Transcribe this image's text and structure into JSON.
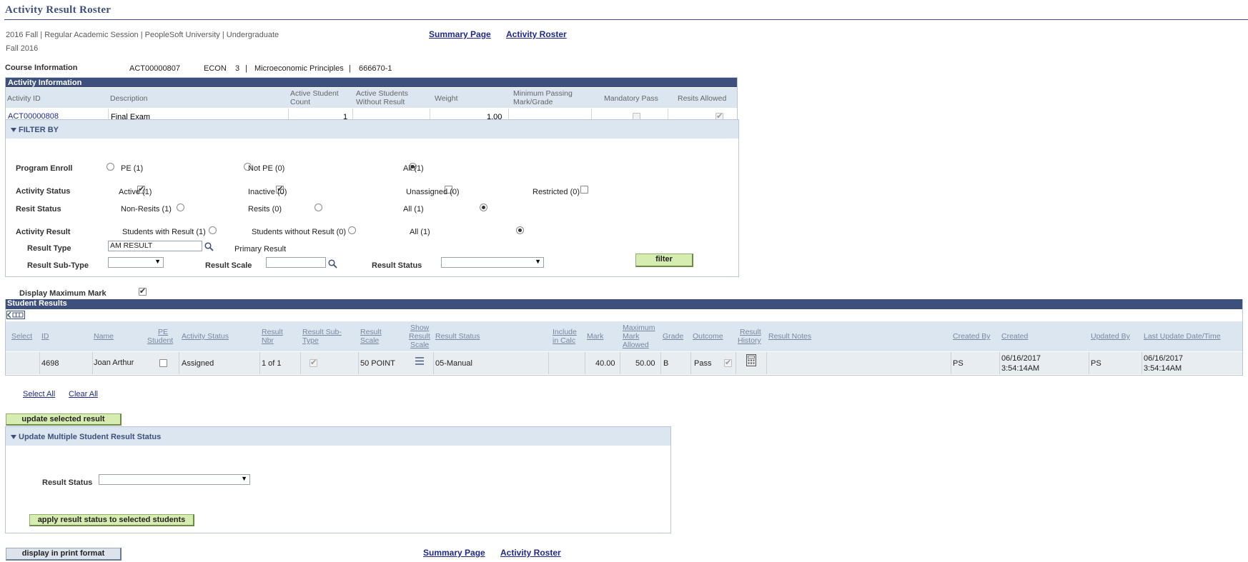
{
  "page": {
    "title": "Activity Result Roster",
    "term_line": "2016 Fall | Regular Academic Session | PeopleSoft University | Undergraduate",
    "term_short": "Fall 2016",
    "links": {
      "summary": "Summary Page",
      "roster": "Activity Roster"
    }
  },
  "course": {
    "label": "Course Information",
    "id": "ACT00000807",
    "subject": "ECON",
    "catalog": "3",
    "separator": "|",
    "title": "Microeconomic Principles",
    "class_nbr": "666670-1"
  },
  "activity": {
    "grid_title": "Activity Information",
    "headers": {
      "id": "Activity ID",
      "description": "Description",
      "active_count_1": "Active Student",
      "active_count_2": "Count",
      "without_result_1": "Active Students",
      "without_result_2": "Without Result",
      "weight": "Weight",
      "min_pass_1": "Minimum Passing",
      "min_pass_2": "Mark/Grade",
      "mandatory": "Mandatory Pass",
      "resits": "Resits Allowed"
    },
    "row": {
      "id": "ACT00000808",
      "description": "Final Exam",
      "active_count": "1",
      "without_result": "",
      "weight": "1.00",
      "min_pass": ""
    }
  },
  "filter": {
    "header": "FILTER BY",
    "program_enroll": {
      "label": "Program Enroll",
      "pe": "PE (1)",
      "not_pe": "Not PE (0)",
      "all": "All (1)"
    },
    "activity_status": {
      "label": "Activity Status",
      "active": "Active (1)",
      "inactive": "Inactive (0)",
      "unassigned": "Unassigned (0)",
      "restricted": "Restricted (0)"
    },
    "resit_status": {
      "label": "Resit Status",
      "non_resits": "Non-Resits (1)",
      "resits": "Resits (0)",
      "all": "All (1)"
    },
    "activity_result": {
      "label": "Activity Result",
      "with": "Students with Result (1)",
      "without": "Students without Result (0)",
      "all": "All (1)"
    },
    "result_type": {
      "label": "Result Type",
      "value": "AM RESULT",
      "description": "Primary Result"
    },
    "result_subtype": {
      "label": "Result Sub-Type",
      "value": ""
    },
    "result_scale": {
      "label": "Result Scale",
      "value": ""
    },
    "result_status": {
      "label": "Result Status",
      "value": ""
    },
    "button": "filter"
  },
  "display_max_mark": "Display Maximum Mark",
  "results": {
    "grid_title": "Student Results",
    "headers": {
      "select": "Select",
      "id": "ID",
      "name": "Name",
      "pe_1": "PE",
      "pe_2": "Student",
      "activity_status": "Activity Status",
      "result_nbr_1": "Result",
      "result_nbr_2": "Nbr",
      "subtype_1": "Result Sub-",
      "subtype_2": "Type",
      "scale_1": "Result",
      "scale_2": "Scale",
      "show_1": "Show",
      "show_2": "Result",
      "show_3": "Scale",
      "result_status": "Result Status",
      "include_1": "Include",
      "include_2": "in Calc",
      "mark": "Mark",
      "max_1": "Maximum",
      "max_2": "Mark",
      "max_3": "Allowed",
      "grade": "Grade",
      "outcome": "Outcome",
      "history_1": "Result",
      "history_2": "History",
      "notes": "Result Notes",
      "created_by": "Created By",
      "created": "Created",
      "updated_by": "Updated By",
      "last_update": "Last Update Date/Time"
    },
    "row": {
      "id": "4698",
      "name": "Joan Arthur",
      "activity_status": "Assigned",
      "result_nbr": "1 of 1",
      "subtype": "",
      "scale": "50 POINT",
      "result_status": "05-Manual",
      "mark": "40.00",
      "max_mark": "50.00",
      "grade": "B",
      "outcome": "Pass",
      "notes": "",
      "created_by": "PS",
      "created_date": "06/16/2017",
      "created_time": "3:54:14AM",
      "updated_by": "PS",
      "updated_date": "06/16/2017",
      "updated_time": "3:54:14AM"
    }
  },
  "select_all": "Select All",
  "clear_all": "Clear All",
  "update_button": "update selected result",
  "update_section": {
    "header": "Update Multiple Student Result Status",
    "result_status_label": "Result Status",
    "result_status_value": "",
    "apply_button": "apply result status to selected students"
  },
  "print_button": "display in print format"
}
